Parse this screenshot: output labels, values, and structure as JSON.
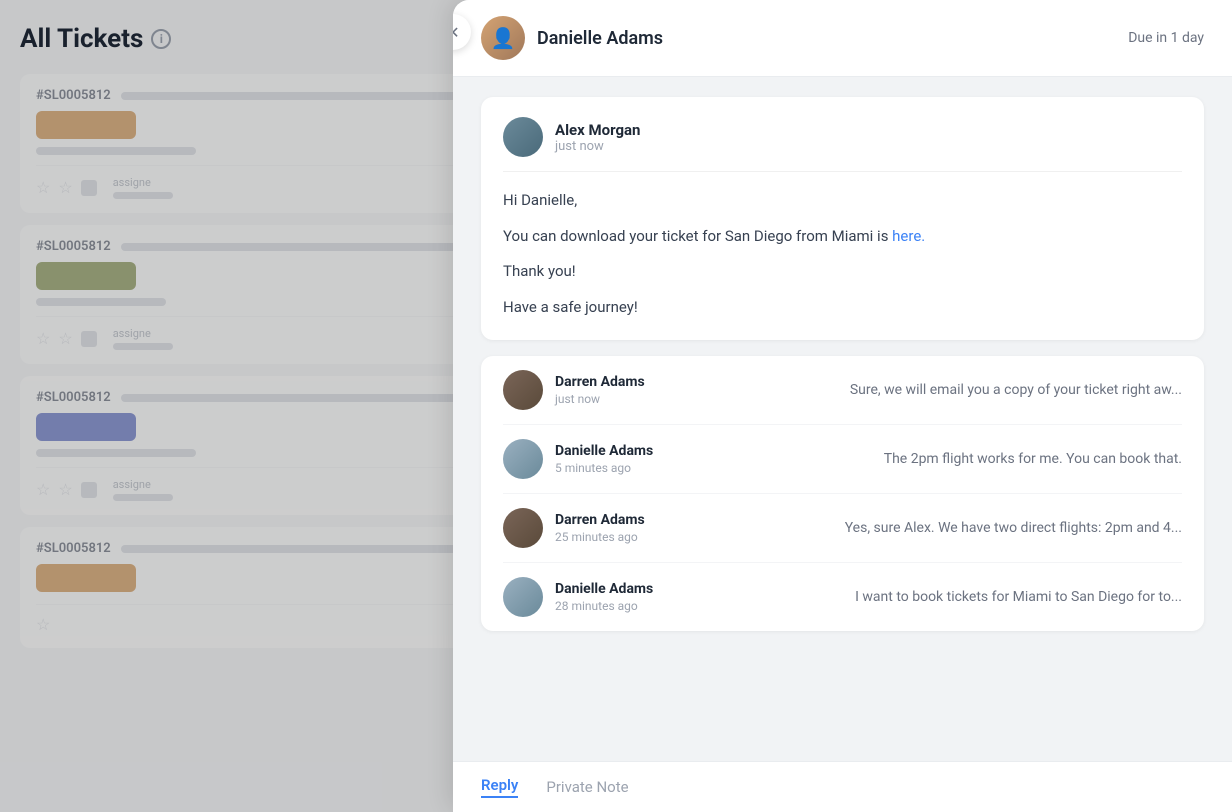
{
  "page": {
    "title": "All Tickets",
    "info_icon": "i"
  },
  "tickets": [
    {
      "id": "#SL0005812",
      "color": "#c97d2a"
    },
    {
      "id": "#SL0005812",
      "color": "#6b7c2a"
    },
    {
      "id": "#SL0005812",
      "color": "#3b4fb5"
    },
    {
      "id": "#SL0005812",
      "color": "#c97d2a"
    }
  ],
  "close_button": "✕",
  "header": {
    "user_name": "Danielle Adams",
    "due_label": "Due in 1 day"
  },
  "main_message": {
    "author": "Alex Morgan",
    "time": "just now",
    "lines": [
      "Hi Danielle,",
      "You can download your ticket for San Diego from Miami is",
      "here.",
      "Thank you!",
      "Have a safe journey!"
    ]
  },
  "conversation": [
    {
      "author": "Darren Adams",
      "time": "just now",
      "preview": "Sure, we will email you a copy of your ticket right aw...",
      "avatar_bg": "#6b5c4e"
    },
    {
      "author": "Danielle Adams",
      "time": "5 minutes ago",
      "preview": "The 2pm flight works for me. You can book that.",
      "avatar_bg": "#8fa8b8"
    },
    {
      "author": "Darren Adams",
      "time": "25 minutes ago",
      "preview": "Yes, sure Alex. We have two direct flights: 2pm and 4...",
      "avatar_bg": "#6b5c4e"
    },
    {
      "author": "Danielle Adams",
      "time": "28 minutes ago",
      "preview": "I want to book tickets for Miami to San Diego for to...",
      "avatar_bg": "#8fa8b8"
    }
  ],
  "reply_tab": {
    "active_label": "Reply",
    "inactive_label": "Private Note"
  }
}
